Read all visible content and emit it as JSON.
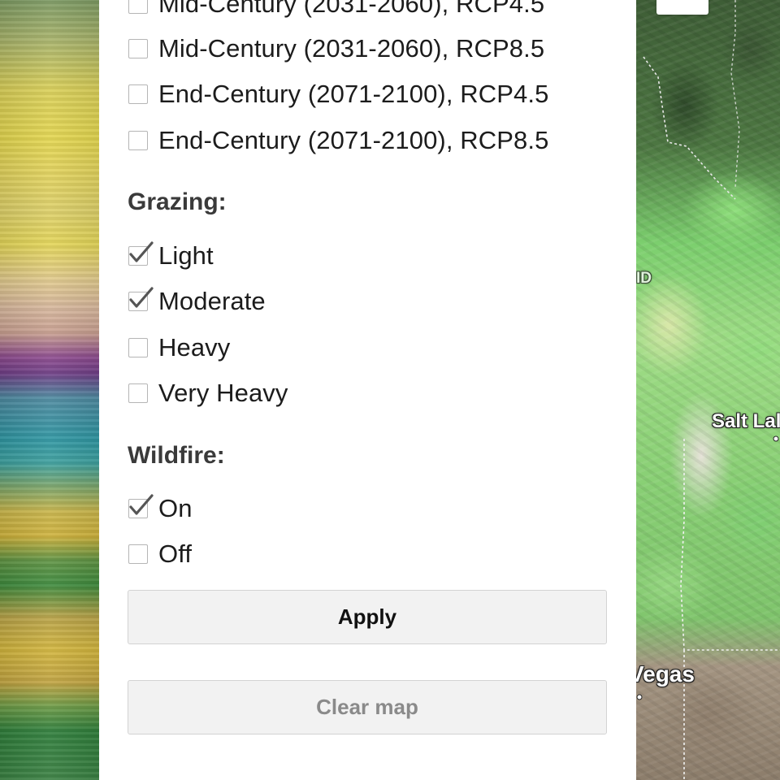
{
  "scenarios": {
    "items": [
      {
        "label": "Mid-Century (2031-2060), RCP4.5",
        "checked": false
      },
      {
        "label": "Mid-Century (2031-2060), RCP8.5",
        "checked": false
      },
      {
        "label": "End-Century (2071-2100), RCP4.5",
        "checked": false
      },
      {
        "label": "End-Century (2071-2100), RCP8.5",
        "checked": false
      }
    ]
  },
  "grazing": {
    "heading": "Grazing:",
    "items": [
      {
        "label": "Light",
        "checked": true
      },
      {
        "label": "Moderate",
        "checked": true
      },
      {
        "label": "Heavy",
        "checked": false
      },
      {
        "label": "Very Heavy",
        "checked": false
      }
    ]
  },
  "wildfire": {
    "heading": "Wildfire:",
    "items": [
      {
        "label": "On",
        "checked": true
      },
      {
        "label": "Off",
        "checked": false
      }
    ]
  },
  "buttons": {
    "apply": "Apply",
    "clear": "Clear map"
  },
  "map": {
    "labels": {
      "state_abbrev": "ID",
      "city_north": "Salt Lal",
      "city_south": "Vegas"
    }
  },
  "colors": {
    "panel_background": "#ffffff",
    "button_background": "#f2f2f2",
    "apply_text": "#111111",
    "clear_text": "#8a8a8a",
    "checkbox_border": "#b5b5b5",
    "checkmark": "#555555"
  }
}
